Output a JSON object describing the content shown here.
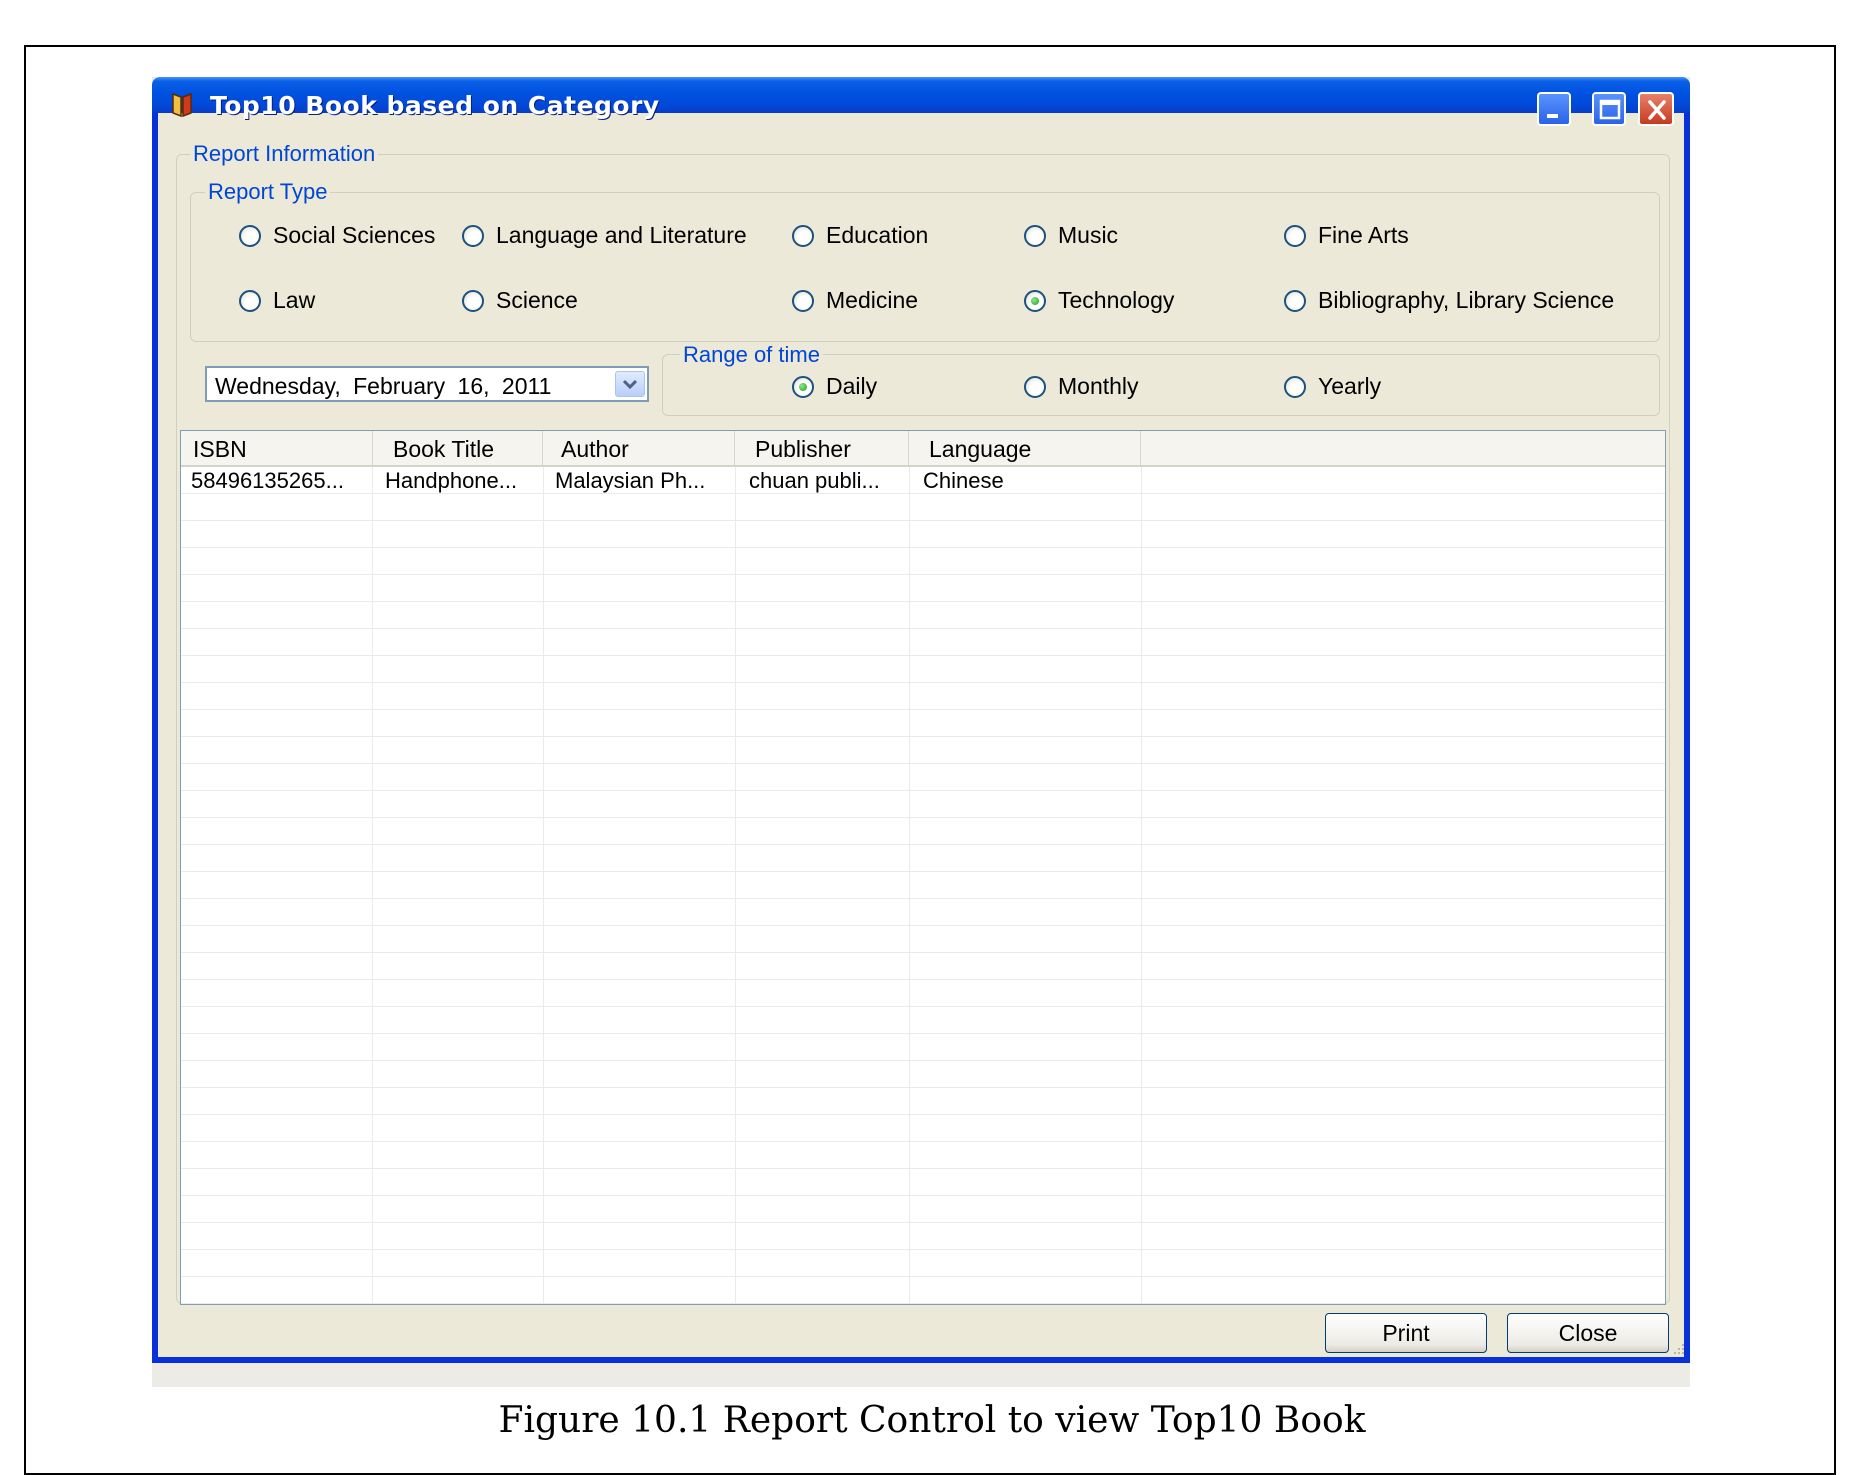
{
  "window": {
    "title": "Top10 Book based on Category"
  },
  "report_info": {
    "legend": "Report Information",
    "report_type": {
      "legend": "Report Type",
      "options": [
        {
          "label": "Social Sciences",
          "checked": false
        },
        {
          "label": "Language and Literature",
          "checked": false
        },
        {
          "label": "Education",
          "checked": false
        },
        {
          "label": "Music",
          "checked": false
        },
        {
          "label": "Fine Arts",
          "checked": false
        },
        {
          "label": "Law",
          "checked": false
        },
        {
          "label": "Science",
          "checked": false
        },
        {
          "label": "Medicine",
          "checked": false
        },
        {
          "label": "Technology",
          "checked": true
        },
        {
          "label": "Bibliography, Library Science",
          "checked": false
        }
      ]
    },
    "date_picker": {
      "value": "Wednesday, February 16, 2011"
    },
    "range_of_time": {
      "legend": "Range of time",
      "options": [
        {
          "label": "Daily",
          "checked": true
        },
        {
          "label": "Monthly",
          "checked": false
        },
        {
          "label": "Yearly",
          "checked": false
        }
      ]
    }
  },
  "grid": {
    "columns": [
      "ISBN",
      "Book Title",
      "Author",
      "Publisher",
      "Language"
    ],
    "rows": [
      [
        "58496135265...",
        "Handphone...",
        "Malaysian Ph...",
        "chuan publi...",
        "Chinese"
      ]
    ]
  },
  "buttons": {
    "print": "Print",
    "close": "Close"
  },
  "caption": "Figure 10.1 Report Control to view Top10 Book",
  "colors": {
    "titlebar": "#0052e0",
    "window_bg": "#ece9d8",
    "legend_text": "#0046d5",
    "radio_checked": "#21a121",
    "close_button": "#c43b1f"
  }
}
